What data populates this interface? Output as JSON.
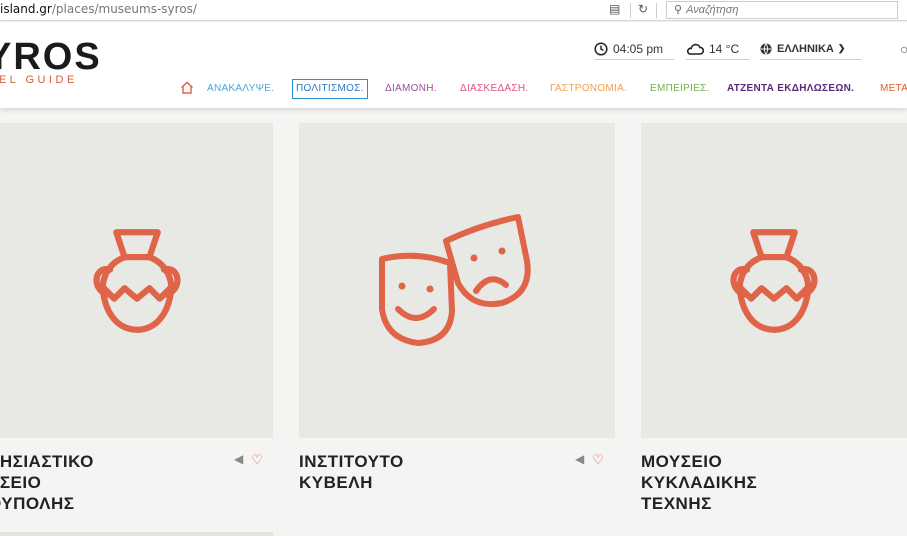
{
  "browser": {
    "url_domain": "island.gr",
    "url_path": "/places/museums-syros/",
    "search_placeholder": "Αναζήτηση"
  },
  "header": {
    "logo": "YROS",
    "logo_sub": "VEL GUIDE",
    "time": "04:05 pm",
    "temperature": "14 °C",
    "language": "ΕΛΛΗΝΙΚΑ"
  },
  "nav": {
    "items": [
      {
        "label": "ΑΝΑΚΑΛΥΨΕ.",
        "color": "#4aa7d8"
      },
      {
        "label": "ΠΟΛΙΤΙΣΜΟΣ.",
        "color": "#2a78c2"
      },
      {
        "label": "ΔΙΑΜΟΝΗ.",
        "color": "#a04a9a"
      },
      {
        "label": "ΔΙΑΣΚΕΔΑΣΗ.",
        "color": "#e0508a"
      },
      {
        "label": "ΓΑΣΤΡΟΝΟΜΙΑ.",
        "color": "#f0a050"
      },
      {
        "label": "ΕΜΠΕΙΡΙΕΣ.",
        "color": "#6fb34a"
      },
      {
        "label": "ΑΤΖΕΝΤΑ ΕΚΔΗΛΩΣΕΩΝ.",
        "color": "#5a2a7a"
      },
      {
        "label": "ΜΕΤΑ",
        "color": "#e05a2a"
      }
    ]
  },
  "cards": [
    {
      "title": "ΛΗΣΙΑΣΤΙΚΟ\nΥΣΕΙΟ\nΟΥΠΟΛΗΣ",
      "icon": "amphora-icon"
    },
    {
      "title": "ΙΝΣΤΙΤΟΥΤΟ\nΚΥΒΕΛΗ",
      "icon": "theatre-masks-icon"
    },
    {
      "title": "ΜΟΥΣΕΙΟ\nΚΥΚΛΑΔΙΚΗΣ\nΤΕΧΝΗΣ",
      "icon": "amphora-icon"
    }
  ],
  "colors": {
    "accent": "#d75a3c",
    "icon": "#e06448",
    "heart": "#e05050"
  }
}
